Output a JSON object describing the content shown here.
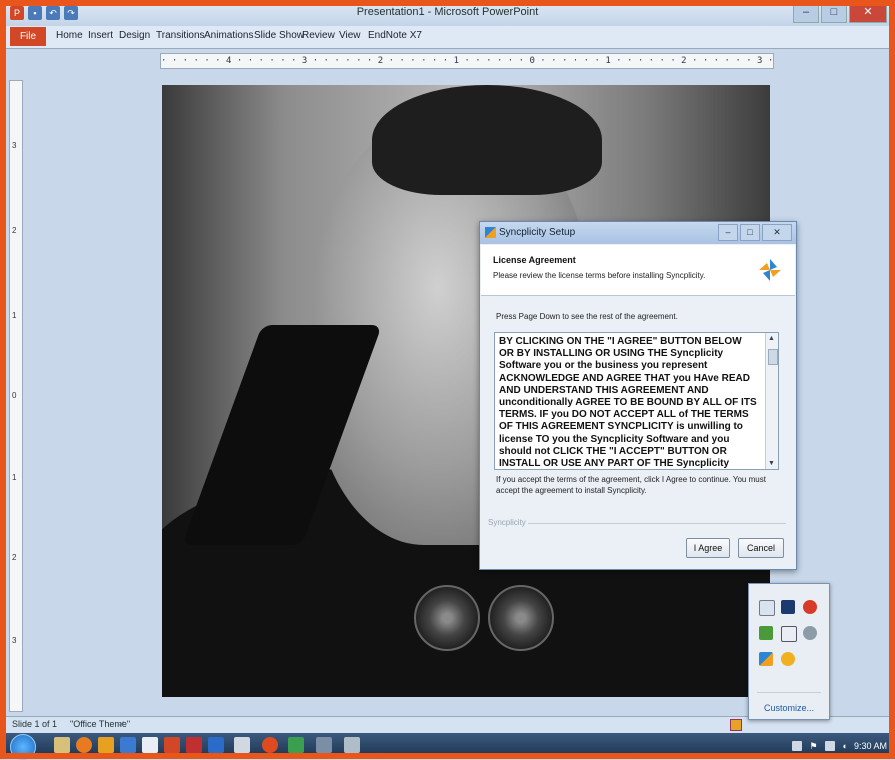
{
  "window": {
    "title": "Presentation1 - Microsoft PowerPoint"
  },
  "ribbon": {
    "file_tab": "File",
    "tabs": [
      "Home",
      "Insert",
      "Design",
      "Transitions",
      "Animations",
      "Slide Show",
      "Review",
      "View",
      "EndNote X7"
    ]
  },
  "ruler": {
    "horizontal": "· · · · · · 4 · · · · · · 3 · · · · · · 2 · · · · · · 1 · · · · · · 0 · · · · · · 1 · · · · · · 2 · · · · · · 3 · · · · · · 4 · · · · · ·",
    "vertical": [
      "3",
      "2",
      "1",
      "0",
      "1",
      "2",
      "3"
    ]
  },
  "dialog": {
    "title": "Syncplicity Setup",
    "heading": "License Agreement",
    "subheading": "Please review the license terms before installing Syncplicity.",
    "instruction": "Press Page Down to see the rest of the agreement.",
    "license_text": "BY CLICKING ON THE \"I AGREE\" BUTTON BELOW OR BY INSTALLING OR USING THE Syncplicity Software you or the business you represent ACKNOWLEDGE AND AGREE THAT you HAve READ AND UNDERSTAND THIS AGREEMENT AND unconditionally AGREE TO BE BOUND BY ALL OF ITS TERMS. IF you DO NOT ACCEPT ALL of THE TERMS OF THIS AGREEMENT SYNCPLICITY is unwilling to license TO you the Syncplicity Software and you should not CLICK THE \"I ACCEPT\" BUTTON OR INSTALL OR USE ANY PART OF THE Syncplicity Software. If you agree to these terms on behalf of a",
    "footer_text": "If you accept the terms of the agreement, click I Agree to continue. You must accept the agreement to install Syncplicity.",
    "brand": "Syncplicity",
    "agree_label": "I Agree",
    "cancel_label": "Cancel"
  },
  "tray_popup": {
    "customize_label": "Customize..."
  },
  "statusbar": {
    "slide_info": "Slide 1 of 1",
    "theme": "\"Office Theme\""
  },
  "taskbar": {
    "clock": "9:30 AM"
  },
  "colors": {
    "accent": "#e8561c",
    "ppt": "#d24726",
    "link": "#1c5aa6"
  }
}
